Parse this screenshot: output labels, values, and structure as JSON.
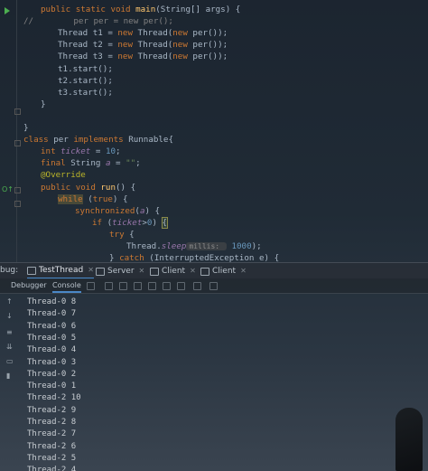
{
  "editor": {
    "lines": [
      {
        "indent": 2,
        "tokens": [
          [
            "kw",
            "public static void "
          ],
          [
            "fn",
            "main"
          ],
          [
            "",
            "(String[] args) {"
          ]
        ]
      },
      {
        "indent": 0,
        "tokens": [
          [
            "cm",
            "//        per per = new per();"
          ]
        ]
      },
      {
        "indent": 3,
        "tokens": [
          [
            "",
            "Thread t1 = "
          ],
          [
            "kw",
            "new "
          ],
          [
            "",
            "Thread("
          ],
          [
            "kw",
            "new "
          ],
          [
            "",
            "per());"
          ]
        ]
      },
      {
        "indent": 3,
        "tokens": [
          [
            "",
            "Thread t2 = "
          ],
          [
            "kw",
            "new "
          ],
          [
            "",
            "Thread("
          ],
          [
            "kw",
            "new "
          ],
          [
            "",
            "per());"
          ]
        ]
      },
      {
        "indent": 3,
        "tokens": [
          [
            "",
            "Thread t3 = "
          ],
          [
            "kw",
            "new "
          ],
          [
            "",
            "Thread("
          ],
          [
            "kw",
            "new "
          ],
          [
            "",
            "per());"
          ]
        ]
      },
      {
        "indent": 3,
        "tokens": [
          [
            "",
            "t1.start();"
          ]
        ]
      },
      {
        "indent": 3,
        "tokens": [
          [
            "",
            "t2.start();"
          ]
        ]
      },
      {
        "indent": 3,
        "tokens": [
          [
            "",
            "t3.start();"
          ]
        ]
      },
      {
        "indent": 2,
        "tokens": [
          [
            "",
            "}"
          ]
        ]
      },
      {
        "indent": 0,
        "tokens": []
      },
      {
        "indent": 1,
        "tokens": [
          [
            "",
            "}"
          ]
        ]
      },
      {
        "indent": 1,
        "tokens": [
          [
            "kw",
            "class "
          ],
          [
            "",
            "per "
          ],
          [
            "kw",
            "implements "
          ],
          [
            "",
            "Runnable{"
          ]
        ]
      },
      {
        "indent": 2,
        "tokens": [
          [
            "kw",
            "int "
          ],
          [
            "st",
            "ticket"
          ],
          [
            "",
            " = "
          ],
          [
            "num",
            "10"
          ],
          [
            "",
            ";"
          ]
        ]
      },
      {
        "indent": 2,
        "tokens": [
          [
            "kw",
            "final "
          ],
          [
            "",
            "String "
          ],
          [
            "st",
            "a"
          ],
          [
            "",
            " = "
          ],
          [
            "str",
            "\"\""
          ],
          [
            "",
            ";"
          ]
        ]
      },
      {
        "indent": 2,
        "tokens": [
          [
            "ann",
            "@Override"
          ]
        ]
      },
      {
        "indent": 2,
        "tokens": [
          [
            "kw",
            "public void "
          ],
          [
            "fn",
            "run"
          ],
          [
            "",
            "() {"
          ]
        ]
      },
      {
        "indent": 3,
        "tokens": [
          [
            "kw hl",
            "while"
          ],
          [
            "",
            " ("
          ],
          [
            "kw",
            "true"
          ],
          [
            "",
            ") {"
          ]
        ]
      },
      {
        "indent": 4,
        "tokens": [
          [
            "kw",
            "synchronized"
          ],
          [
            "",
            "("
          ],
          [
            "st",
            "a"
          ],
          [
            "",
            ") {"
          ]
        ]
      },
      {
        "indent": 5,
        "tokens": [
          [
            "kw",
            "if "
          ],
          [
            "",
            "("
          ],
          [
            "st",
            "ticket"
          ],
          [
            "",
            ">"
          ],
          [
            "num",
            "0"
          ],
          [
            "",
            ") "
          ],
          [
            "brace-match",
            "{"
          ]
        ]
      },
      {
        "indent": 6,
        "tokens": [
          [
            "kw",
            "try "
          ],
          [
            "",
            "{"
          ]
        ]
      },
      {
        "indent": 7,
        "tokens": [
          [
            "",
            "Thread."
          ],
          [
            "st",
            "sleep"
          ],
          [
            "",
            ""
          ],
          [
            "hint",
            "millis: "
          ],
          [
            "num",
            " 1000"
          ],
          [
            "",
            ");"
          ]
        ]
      },
      {
        "indent": 6,
        "tokens": [
          [
            "",
            "} "
          ],
          [
            "kw",
            "catch "
          ],
          [
            "",
            "(InterruptedException e) {"
          ]
        ]
      }
    ]
  },
  "debug": {
    "title": "bug:",
    "tabs": [
      {
        "label": "TestThread",
        "active": true
      },
      {
        "label": "Server",
        "active": false
      },
      {
        "label": "Client",
        "active": false
      },
      {
        "label": "Client",
        "active": false
      }
    ],
    "subtabs": [
      {
        "label": "Debugger",
        "active": false
      },
      {
        "label": "Console",
        "active": true
      }
    ],
    "output": [
      "Thread-0 8",
      "Thread-0 7",
      "Thread-0 6",
      "Thread-0 5",
      "Thread-0 4",
      "Thread-0 3",
      "Thread-0 2",
      "Thread-0 1",
      "Thread-2 10",
      "Thread-2 9",
      "Thread-2 8",
      "Thread-2 7",
      "Thread-2 6",
      "Thread-2 5",
      "Thread-2 4"
    ],
    "side_icons": [
      "restore-layout-icon",
      "soft-wrap-icon",
      "scroll-to-end-icon",
      "print-icon",
      "clear-all-icon"
    ]
  },
  "colors": {
    "accent": "#4a88c7",
    "run_green": "#4caf50"
  }
}
